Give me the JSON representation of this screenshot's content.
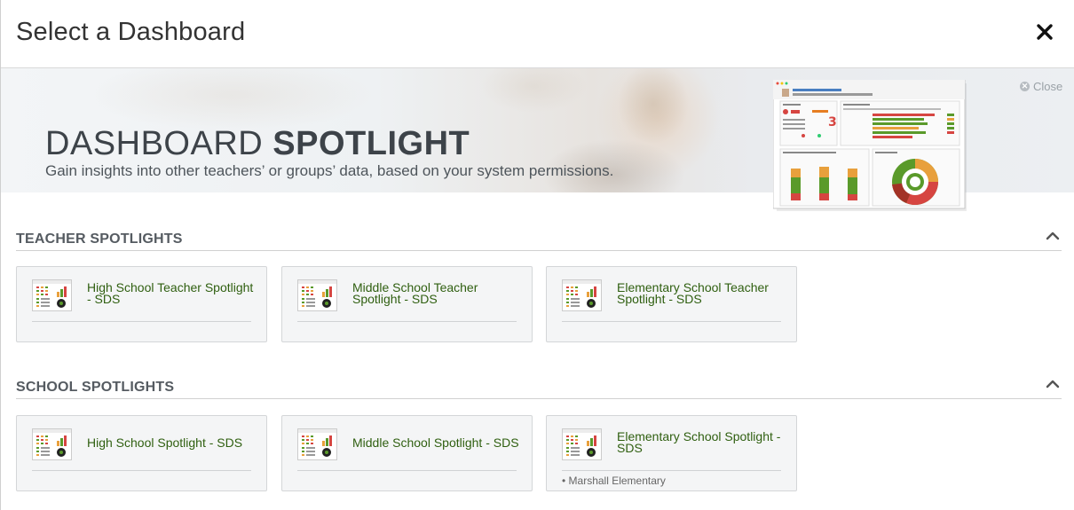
{
  "header": {
    "title": "Select a Dashboard",
    "close_icon": "close-x-icon"
  },
  "banner": {
    "title_light": "DASHBOARD ",
    "title_bold": "SPOTLIGHT",
    "subtitle": "Gain insights into other teachers’ or groups’ data, based on your system permissions.",
    "close_label": "Close"
  },
  "sections": [
    {
      "title": "TEACHER SPOTLIGHTS",
      "cards": [
        {
          "label": "High School Teacher Spotlight - SDS"
        },
        {
          "label": "Middle School Teacher Spotlight - SDS"
        },
        {
          "label": "Elementary School Teacher Spotlight - SDS"
        }
      ]
    },
    {
      "title": "SCHOOL SPOTLIGHTS",
      "cards": [
        {
          "label": "High School Spotlight - SDS"
        },
        {
          "label": "Middle School Spotlight - SDS"
        },
        {
          "label": "Elementary School Spotlight - SDS",
          "meta": "• Marshall Elementary"
        }
      ]
    }
  ],
  "colors": {
    "card_text": "#2f5f10",
    "accent_green": "#5a9a2a",
    "accent_red": "#c0392b",
    "accent_orange": "#e8a03c"
  }
}
